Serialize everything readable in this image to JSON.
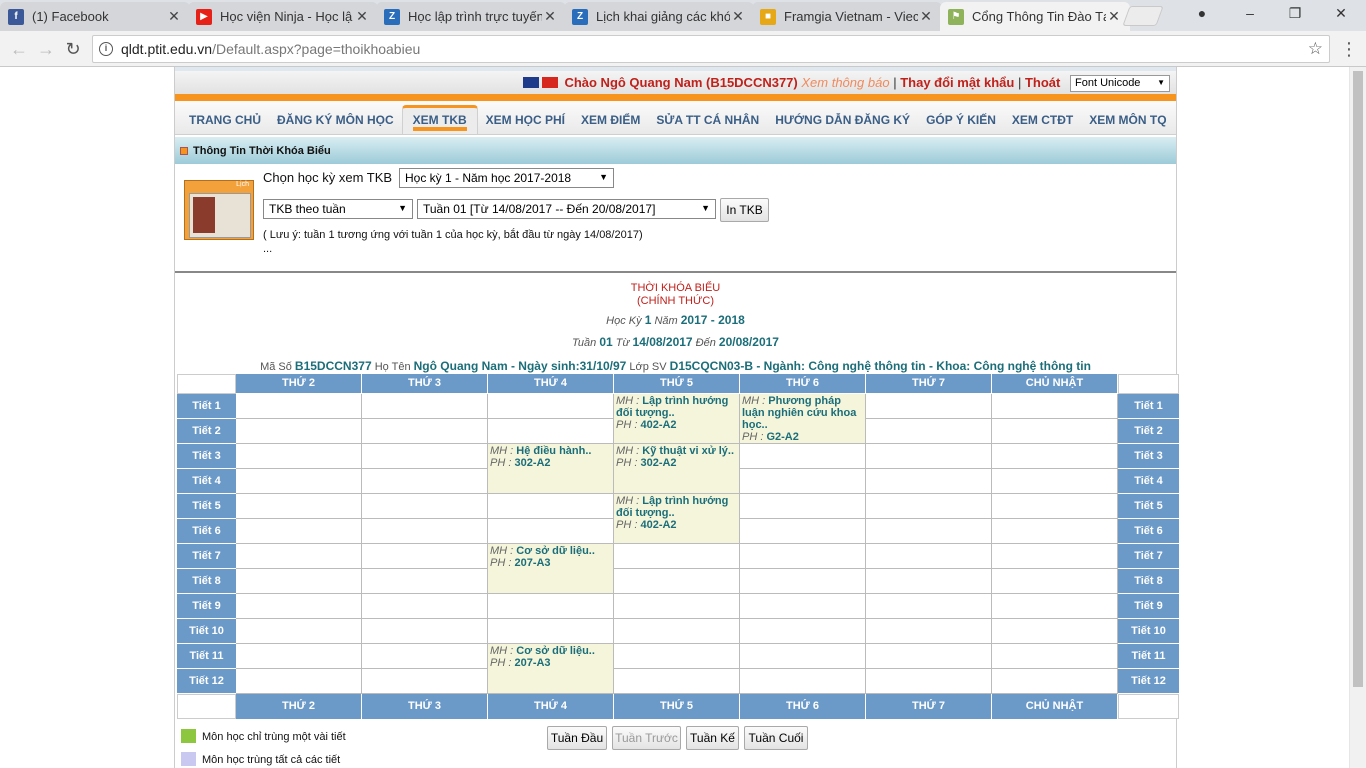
{
  "browser": {
    "tabs": [
      {
        "title": "(1) Facebook",
        "icon": "facebook-icon",
        "color": "#3b5998",
        "glyph": "f"
      },
      {
        "title": "Học viện Ninja - Học lậ",
        "icon": "youtube-icon",
        "color": "#e62117",
        "glyph": "▶"
      },
      {
        "title": "Học lập trình trực tuyến",
        "icon": "z-icon",
        "color": "#2a6ebb",
        "glyph": "Z"
      },
      {
        "title": "Lịch khai giảng các khó",
        "icon": "z-icon",
        "color": "#2a6ebb",
        "glyph": "Z"
      },
      {
        "title": "Framgia Vietnam - Viec",
        "icon": "briefcase-icon",
        "color": "#e6a817",
        "glyph": "■"
      },
      {
        "title": "Cổng Thông Tin Đào Tạ",
        "icon": "page-icon",
        "color": "#8fb35a",
        "glyph": "⚑"
      }
    ],
    "url_host": "qldt.ptit.edu.vn",
    "url_path": "/Default.aspx?page=thoikhoabieu"
  },
  "topbar": {
    "greeting": "Chào Ngô Quang Nam (B15DCCN377)",
    "notice": "Xem thông báo",
    "change_password": "Thay đổi mật khẩu",
    "logout": "Thoát",
    "font_select": "Font Unicode"
  },
  "menu": [
    "TRANG CHỦ",
    "ĐĂNG KÝ MÔN HỌC",
    "XEM TKB",
    "XEM HỌC PHÍ",
    "XEM ĐIỂM",
    "SỬA TT CÁ NHÂN",
    "HƯỚNG DẪN ĐĂNG KÝ",
    "GÓP Ý KIẾN",
    "XEM CTĐT",
    "XEM MÔN TQ"
  ],
  "menu_active": "XEM TKB",
  "panel": {
    "title": "Thông Tin Thời Khóa Biểu",
    "calendar_label": "Lịch",
    "semester_label": "Chọn học kỳ xem TKB",
    "semester_value": "Học kỳ 1 - Năm học 2017-2018",
    "view_mode": "TKB theo tuần",
    "week_value": "Tuần 01 [Từ 14/08/2017 -- Đến 20/08/2017]",
    "print_button": "In TKB",
    "note": "( Lưu ý: tuần 1 tương ứng với tuần 1 của học kỳ, bắt đầu từ ngày 14/08/2017)",
    "ellipsis": "..."
  },
  "tkb": {
    "title": "THỜI KHÓA BIỂU",
    "subtitle": "(CHÍNH THỨC)",
    "hk_label": "Học Kỳ",
    "hk_value": "1",
    "nam_label": "Năm",
    "nam_value": "2017 - 2018",
    "tuan_label": "Tuần",
    "tuan_value": "01",
    "tu_label": "Từ",
    "tu_value": "14/08/2017",
    "den_label": "Đến",
    "den_value": "20/08/2017",
    "maso_label": "Mã Số",
    "maso_value": "B15DCCN377",
    "hoten_label": "Họ Tên",
    "hoten_value": "Ngô Quang Nam - Ngày sinh:31/10/97",
    "lop_label": "Lớp SV",
    "lop_value": "D15CQCN03-B - Ngành: Công nghệ thông tin - Khoa: Công nghệ thông tin"
  },
  "days": [
    "THỨ 2",
    "THỨ 3",
    "THỨ 4",
    "THỨ 5",
    "THỨ 6",
    "THỨ 7",
    "CHỦ NHẬT"
  ],
  "periods": [
    "Tiết 1",
    "Tiết 2",
    "Tiết 3",
    "Tiết 4",
    "Tiết 5",
    "Tiết 6",
    "Tiết 7",
    "Tiết 8",
    "Tiết 9",
    "Tiết 10",
    "Tiết 11",
    "Tiết 12"
  ],
  "courses": [
    {
      "day": 3,
      "start": 1,
      "span": 2,
      "mh_label": "MH :",
      "name": "Lập trình hướng đối tượng..",
      "ph_label": "PH :",
      "room": "402-A2"
    },
    {
      "day": 4,
      "start": 1,
      "span": 2,
      "mh_label": "MH :",
      "name": "Phương pháp luận nghiên cứu khoa học..",
      "ph_label": "PH :",
      "room": "G2-A2"
    },
    {
      "day": 2,
      "start": 3,
      "span": 2,
      "mh_label": "MH :",
      "name": "Hệ điều hành..",
      "ph_label": "PH :",
      "room": "302-A2"
    },
    {
      "day": 3,
      "start": 3,
      "span": 2,
      "mh_label": "MH :",
      "name": "Kỹ thuật vi xử lý..",
      "ph_label": "PH :",
      "room": "302-A2"
    },
    {
      "day": 3,
      "start": 5,
      "span": 2,
      "mh_label": "MH :",
      "name": "Lập trình hướng đối tượng..",
      "ph_label": "PH :",
      "room": "402-A2"
    },
    {
      "day": 2,
      "start": 7,
      "span": 2,
      "mh_label": "MH :",
      "name": "Cơ sở dữ liệu..",
      "ph_label": "PH :",
      "room": "207-A3"
    },
    {
      "day": 2,
      "start": 11,
      "span": 2,
      "mh_label": "MH :",
      "name": "Cơ sở dữ liệu..",
      "ph_label": "PH :",
      "room": "207-A3"
    }
  ],
  "nav_buttons": {
    "first": "Tuần Đầu",
    "prev": "Tuần Trước",
    "next": "Tuần Kế",
    "last": "Tuần Cuối"
  },
  "legend": [
    {
      "label": "Môn học chỉ trùng một vài tiết",
      "color": "#8dc63f"
    },
    {
      "label": "Môn học trùng tất cả các tiết",
      "color": "#c8c8f0"
    }
  ],
  "colors": {
    "accent": "#f7941d",
    "header_blue": "#6b9ac8",
    "course_bg": "#f5f5dc",
    "link_red": "#c0211b"
  }
}
